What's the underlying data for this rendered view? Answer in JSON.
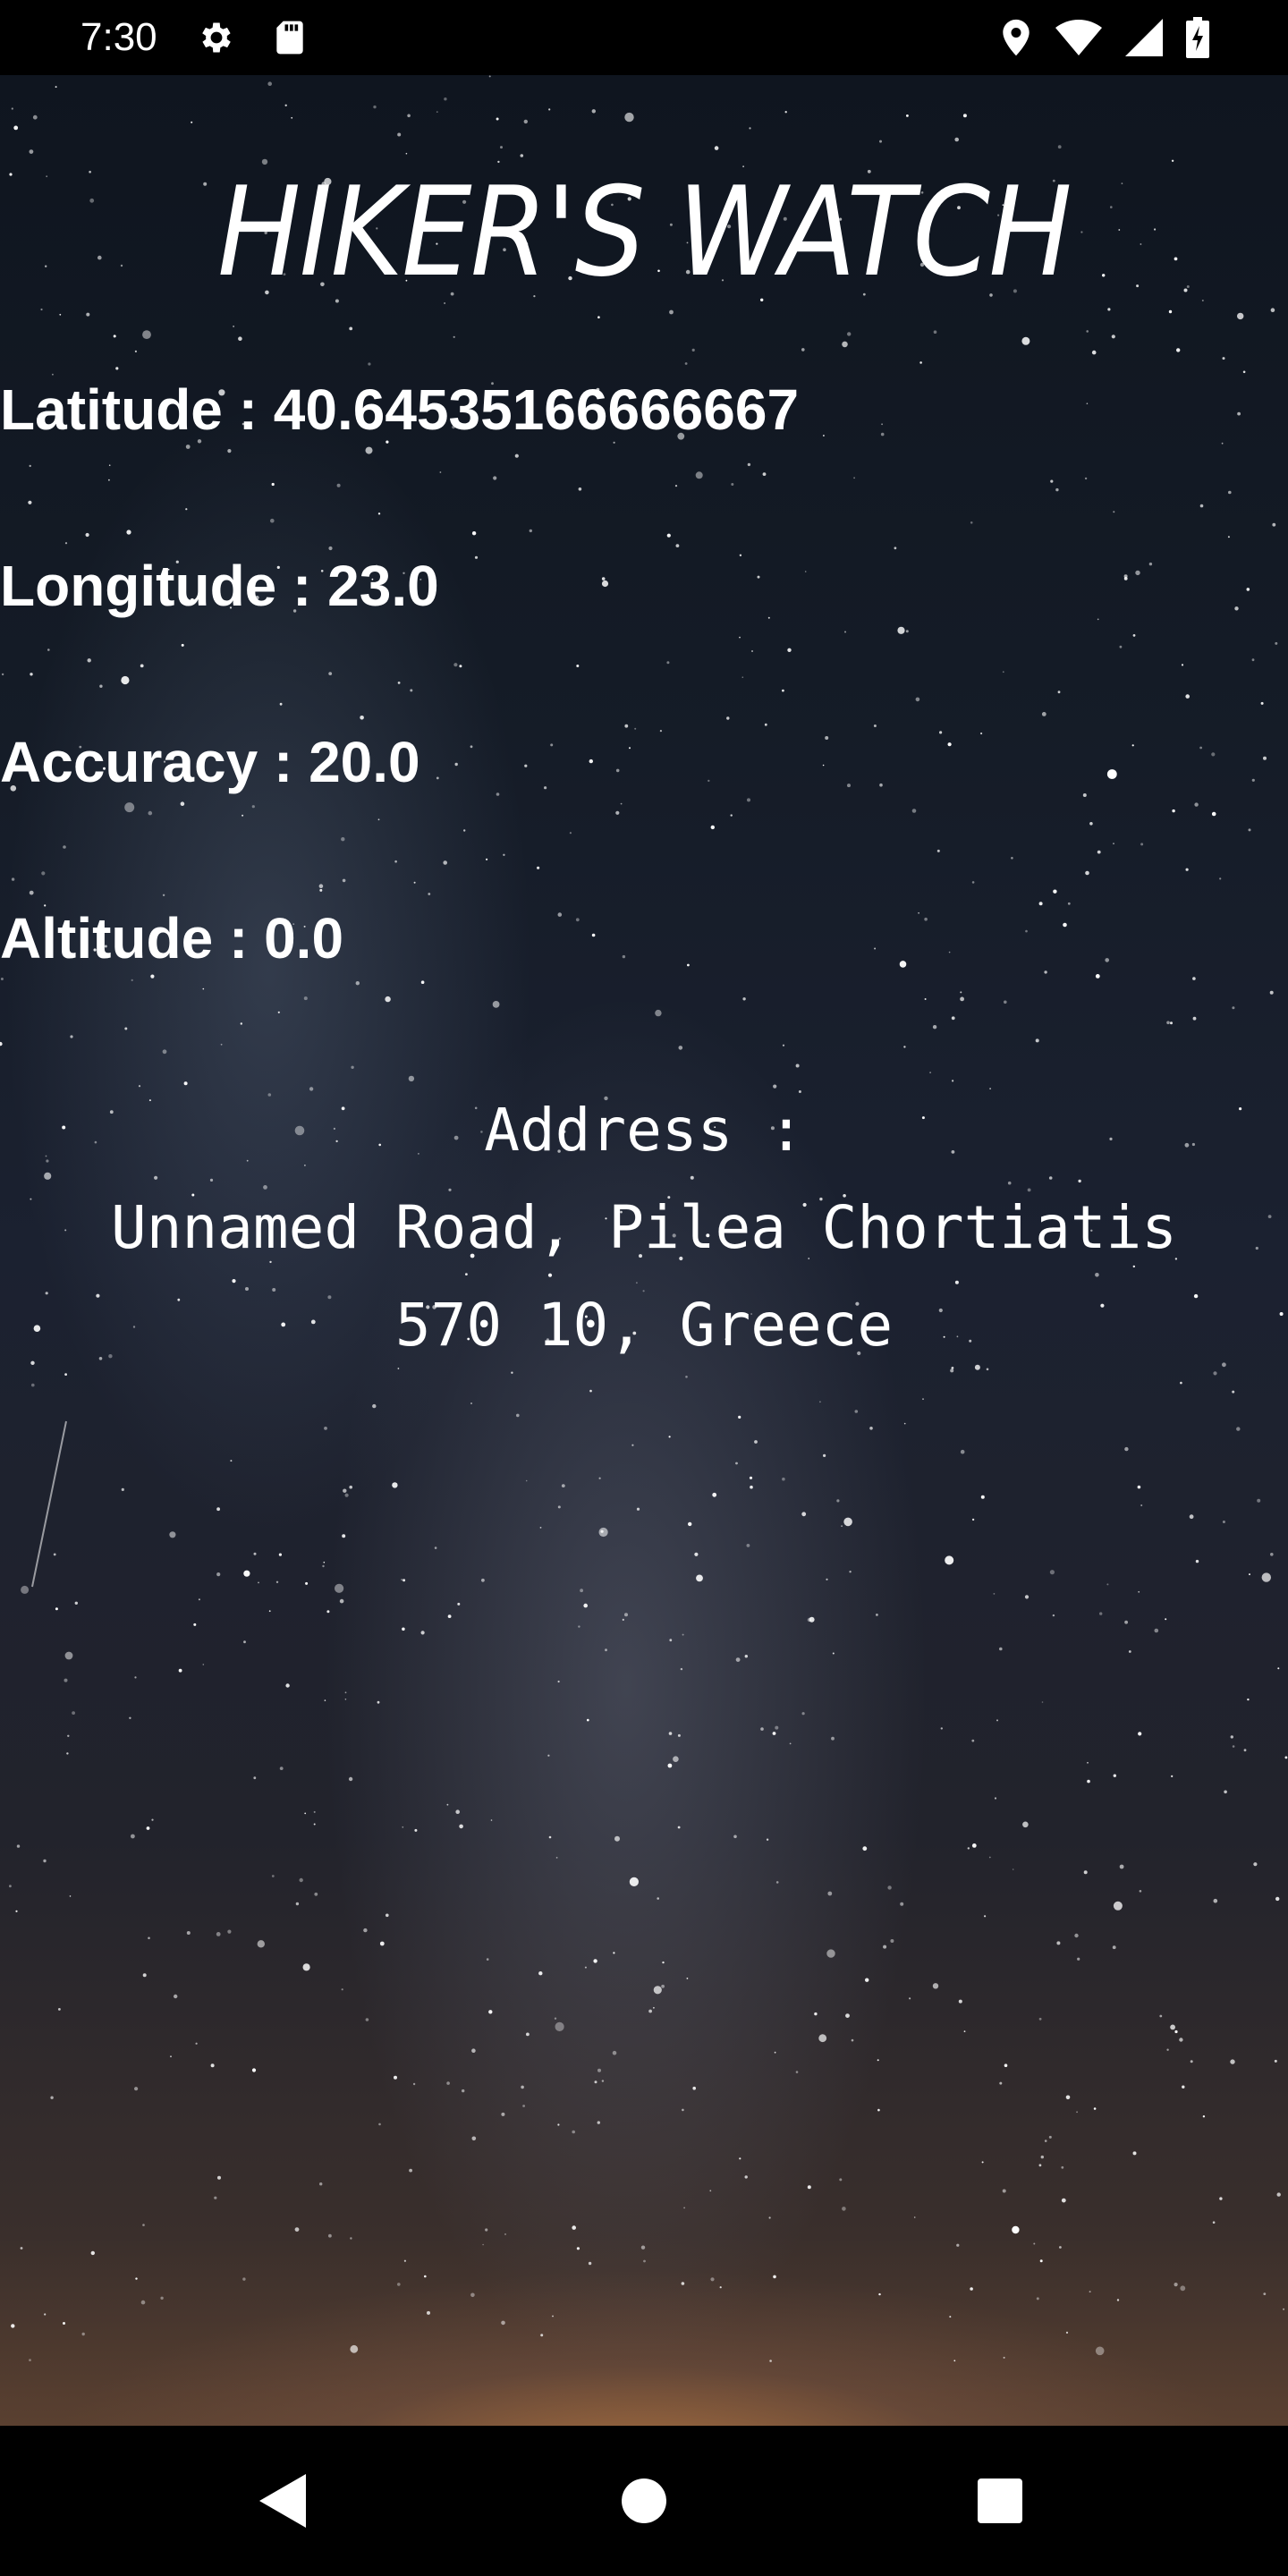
{
  "status_bar": {
    "time": "7:30",
    "icons_left": [
      "settings-icon",
      "sd-card-icon"
    ],
    "icons_right": [
      "location-icon",
      "wifi-icon",
      "signal-icon",
      "battery-charging-icon"
    ]
  },
  "app": {
    "title": "HIKER'S WATCH",
    "latitude": "Latitude : 40.64535166666667",
    "longitude": "Longitude : 23.0",
    "accuracy": "Accuracy : 20.0",
    "altitude": "Altitude : 0.0",
    "address_label": "Address :",
    "address_line1": "Unnamed Road, Pilea Chortiatis",
    "address_line2": "570 10, Greece"
  },
  "nav_bar": {
    "buttons": [
      "back-icon",
      "home-icon",
      "recents-icon"
    ]
  },
  "colors": {
    "text": "#ffffff",
    "bars": "#000000",
    "sky_top": "#0f151f",
    "horizon_glow": "#c48046"
  }
}
